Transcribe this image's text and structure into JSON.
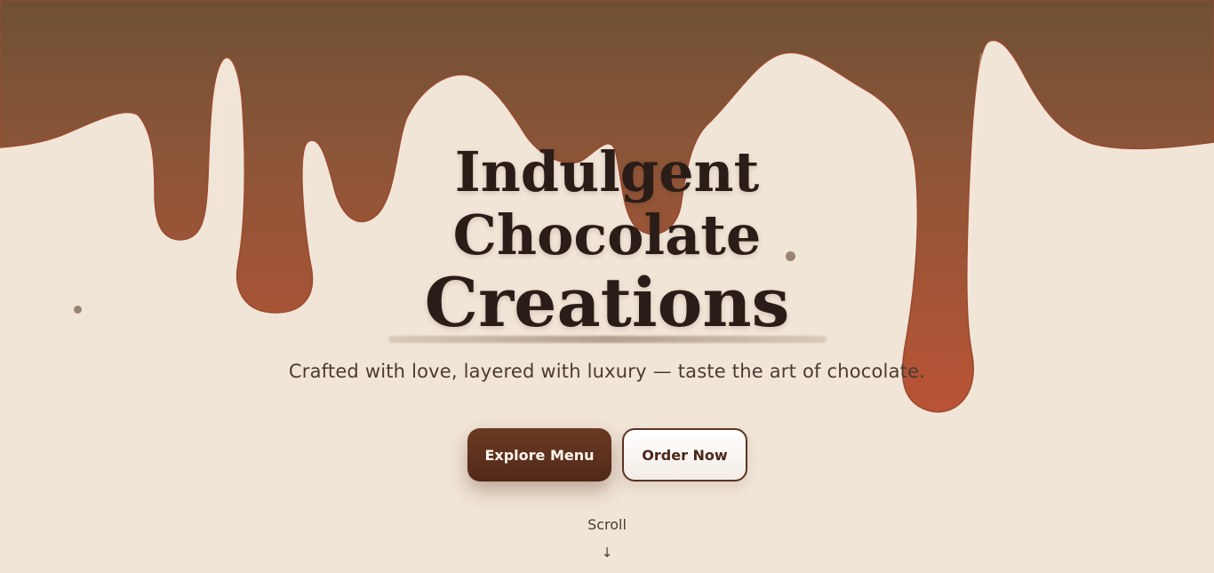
{
  "hero": {
    "title_line1": "Indulgent",
    "title_line2": "Chocolate",
    "title_line3": "Creations",
    "subtitle": "Crafted with love, layered with luxury — taste the art of chocolate.",
    "primary_button_label": "Explore Menu",
    "secondary_button_label": "Order Now",
    "scroll_label": "Scroll",
    "scroll_arrow": "↓"
  },
  "decor": {
    "drip_icon": "chocolate-drip",
    "scroll_icon": "arrow-down-icon"
  },
  "colors": {
    "background": "#f1e5d8",
    "chocolate_top": "#6e4f33",
    "chocolate_bottom": "#b65435",
    "text_dark": "#2a1d17",
    "button_primary": "#5c301e",
    "button_secondary_border": "#5a3322"
  }
}
